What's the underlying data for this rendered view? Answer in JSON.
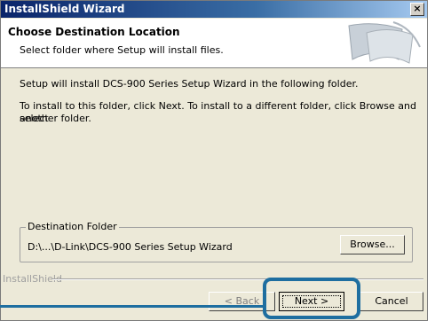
{
  "window": {
    "title": "InstallShield Wizard",
    "close_label": "×"
  },
  "header": {
    "title": "Choose Destination Location",
    "subtitle": "Select folder where Setup will install files."
  },
  "body": {
    "line1": "Setup will install DCS-900 Series Setup Wizard in the following folder.",
    "line2": "To install to this folder, click Next. To install to a different folder, click Browse and select",
    "line3": "another folder."
  },
  "destination": {
    "group_label": "Destination Folder",
    "path": "D:\\...\\D-Link\\DCS-900 Series Setup Wizard",
    "browse_label": "Browse..."
  },
  "footer": {
    "brand": "InstallShield",
    "back_label": "< Back",
    "next_label": "Next >",
    "cancel_label": "Cancel"
  },
  "colors": {
    "highlight": "#1e6ea0",
    "titlebar": "#0a246a"
  }
}
